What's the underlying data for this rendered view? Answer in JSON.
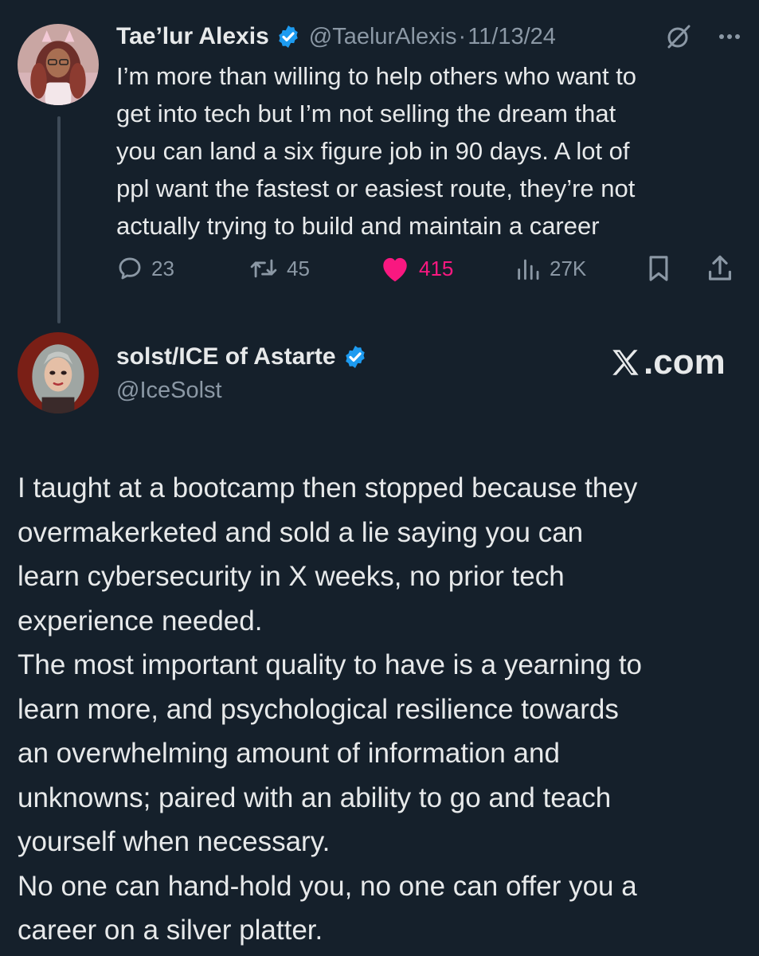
{
  "tweet1": {
    "author_name": "Tae’lur Alexis",
    "handle": "@TaelurAlexis",
    "separator": "·",
    "date": "11/13/24",
    "lines": [
      "I’m more than willing to help others who want to",
      "get into tech but I’m not selling the dream that",
      "you can land a six figure job in 90 days. A lot of",
      "ppl want the fastest or easiest route, they’re not",
      "actually trying to build and maintain a career"
    ],
    "actions": {
      "replies": "23",
      "reposts": "45",
      "likes": "415",
      "views": "27K"
    },
    "icons": [
      "verified-badge-icon",
      "grok-icon",
      "more-icon",
      "reply-icon",
      "repost-icon",
      "heart-icon",
      "views-icon",
      "bookmark-icon",
      "share-icon"
    ],
    "like_color": "#f91880"
  },
  "tweet2": {
    "author_name": "solst/ICE of Astarte",
    "handle": "@IceSolst",
    "watermark_suffix": ".com",
    "lines": [
      "I taught at a bootcamp then stopped because they",
      "overmakerketed and sold a lie saying you can",
      "learn cybersecurity in X weeks, no prior tech",
      "experience needed.",
      "The most important quality to have is a yearning to",
      "learn more, and psychological resilience towards",
      "an overwhelming amount of information and",
      "unknowns; paired with an ability to go and teach",
      "yourself when necessary.",
      "No one can hand-hold you, no one can offer you a",
      "career on a silver platter."
    ]
  },
  "theme": {
    "background": "#15202b",
    "text": "#e7e9ea",
    "muted": "#8b98a5",
    "verified": "#1d9bf0"
  }
}
